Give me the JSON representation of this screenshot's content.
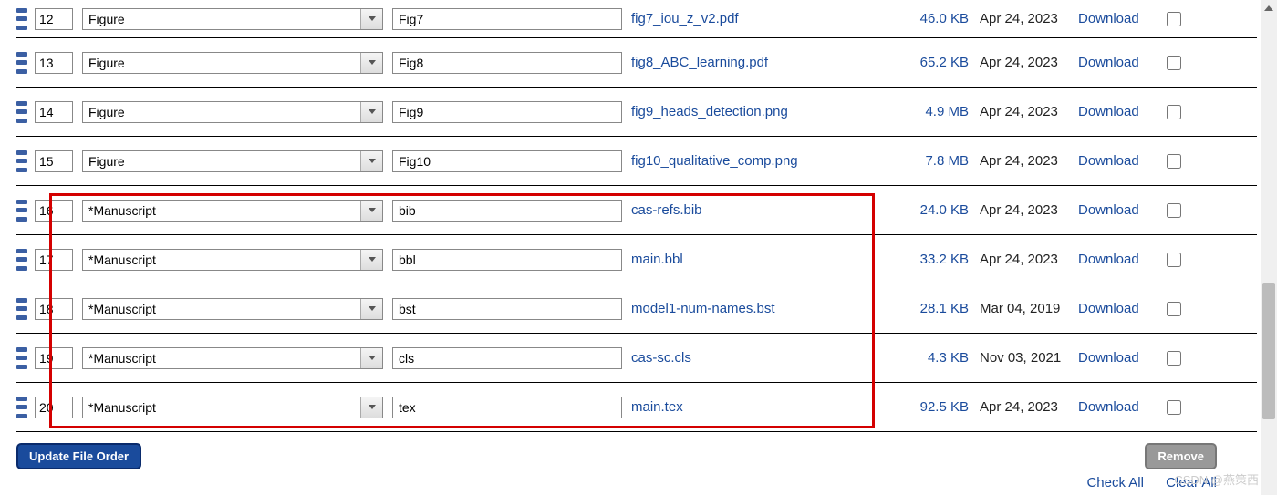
{
  "rows": [
    {
      "order": "12",
      "type": "Figure",
      "desc": "Fig7",
      "filename": "fig7_iou_z_v2.pdf",
      "size": "46.0 KB",
      "date": "Apr 24, 2023"
    },
    {
      "order": "13",
      "type": "Figure",
      "desc": "Fig8",
      "filename": "fig8_ABC_learning.pdf",
      "size": "65.2 KB",
      "date": "Apr 24, 2023"
    },
    {
      "order": "14",
      "type": "Figure",
      "desc": "Fig9",
      "filename": "fig9_heads_detection.png",
      "size": "4.9 MB",
      "date": "Apr 24, 2023"
    },
    {
      "order": "15",
      "type": "Figure",
      "desc": "Fig10",
      "filename": "fig10_qualitative_comp.png",
      "size": "7.8 MB",
      "date": "Apr 24, 2023"
    },
    {
      "order": "16",
      "type": "*Manuscript",
      "desc": "bib",
      "filename": "cas-refs.bib",
      "size": "24.0 KB",
      "date": "Apr 24, 2023"
    },
    {
      "order": "17",
      "type": "*Manuscript",
      "desc": "bbl",
      "filename": "main.bbl",
      "size": "33.2 KB",
      "date": "Apr 24, 2023"
    },
    {
      "order": "18",
      "type": "*Manuscript",
      "desc": "bst",
      "filename": "model1-num-names.bst",
      "size": "28.1 KB",
      "date": "Mar 04, 2019"
    },
    {
      "order": "19",
      "type": "*Manuscript",
      "desc": "cls",
      "filename": "cas-sc.cls",
      "size": "4.3 KB",
      "date": "Nov 03, 2021"
    },
    {
      "order": "20",
      "type": "*Manuscript",
      "desc": "tex",
      "filename": "main.tex",
      "size": "92.5 KB",
      "date": "Apr 24, 2023"
    }
  ],
  "actions": {
    "download": "Download",
    "update_order": "Update File Order",
    "remove": "Remove",
    "check_all": "Check All",
    "clear_all": "Clear All"
  },
  "watermark": "CSDN @燕策西"
}
